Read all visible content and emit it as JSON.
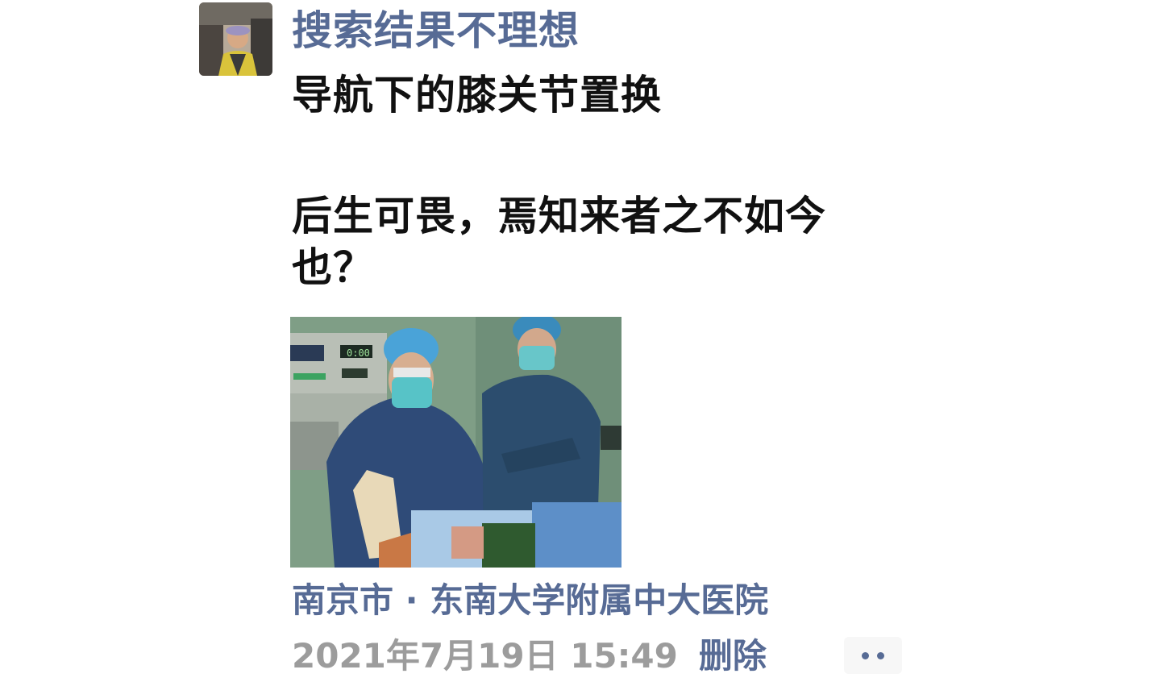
{
  "post": {
    "author": "搜索结果不理想",
    "text_lines": [
      "导航下的膝关节置换",
      "后生可畏，焉知来者之不如今",
      "也？"
    ],
    "location": "南京市 · 东南大学附属中大医院",
    "timestamp": "2021年7月19日 15:49",
    "delete_label": "删除"
  },
  "photo": {
    "monitor_display": "0:00"
  },
  "colors": {
    "link": "#576b95",
    "text": "#111111",
    "meta": "#9c9c9c",
    "background": "#ffffff"
  },
  "icons": {
    "more": "more-dots-icon"
  }
}
